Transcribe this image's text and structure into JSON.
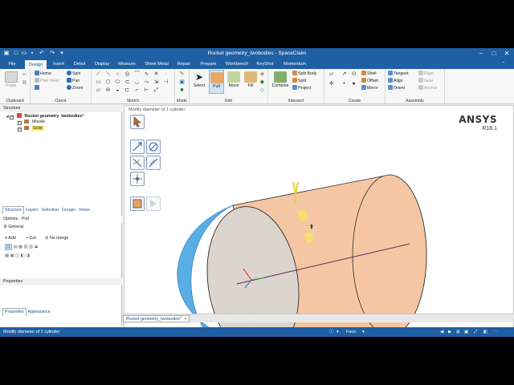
{
  "window": {
    "title": "Rocket geometry_twobodies - SpaceClaim",
    "controls": [
      "minimize-icon",
      "maximize-icon",
      "close-icon"
    ]
  },
  "quick_access": [
    "new-icon",
    "open-icon",
    "save-icon",
    "undo-icon",
    "redo-icon"
  ],
  "menu": {
    "items": [
      {
        "label": "File"
      },
      {
        "label": "Design",
        "active": true
      },
      {
        "label": "Insert"
      },
      {
        "label": "Detail"
      },
      {
        "label": "Display"
      },
      {
        "label": "Measure"
      },
      {
        "label": "Sheet Metal"
      },
      {
        "label": "Repair"
      },
      {
        "label": "Prepare"
      },
      {
        "label": "Workbench"
      },
      {
        "label": "KeyShot"
      },
      {
        "label": "Momentum"
      }
    ]
  },
  "ribbon": {
    "clipboard": {
      "label": "Clipboard",
      "paste": "Paste"
    },
    "orient": {
      "label": "Orient",
      "home": "Home",
      "plan_view": "Plan View",
      "spin": "Spin",
      "pan": "Pan",
      "zoom": "Zoom"
    },
    "sketch": {
      "label": "Sketch"
    },
    "mode": {
      "label": "Mode"
    },
    "edit": {
      "label": "Edit",
      "select": "Select",
      "pull": "Pull",
      "move": "Move",
      "fill": "Fill"
    },
    "intersect": {
      "label": "Intersect",
      "combine": "Combine",
      "split_body": "Split Body",
      "split": "Split",
      "project": "Project"
    },
    "create": {
      "label": "Create",
      "shell": "Shell",
      "offset": "Offset",
      "mirror": "Mirror"
    },
    "assembly": {
      "label": "Assembly",
      "tangent": "Tangent",
      "align": "Align",
      "orient": "Orient",
      "rigid": "Rigid",
      "gear": "Gear",
      "anchor": "Anchor"
    }
  },
  "structure": {
    "header": "Structure",
    "root": "Rocket geometry_twobodies*",
    "children": [
      "Missile",
      "Solid"
    ]
  },
  "panel_tabs": [
    "Structure",
    "Layers",
    "Selection",
    "Groups",
    "Views"
  ],
  "options": {
    "header": "Options - Pull",
    "section": "General",
    "add": "Add",
    "cut": "Cut",
    "no_merge": "No merge"
  },
  "properties": {
    "header": "Properties"
  },
  "bottom_tabs": [
    "Properties",
    "Appearance"
  ],
  "viewport": {
    "hint": "Modify diameter of 1 cylinder",
    "brand": "ANSYS",
    "version": "R18.1"
  },
  "document_tab": {
    "label": "Rocket geometry_twobodies*",
    "close": "×"
  },
  "status": {
    "message": "Modify diameter of 1 cylinder",
    "filter": "Face"
  },
  "colors": {
    "title_bar": "#1f5fa3",
    "cylinder_fill": "#f6c8a6",
    "sphere_fill": "#5aaee6",
    "end_face": "#d8d2cc"
  }
}
